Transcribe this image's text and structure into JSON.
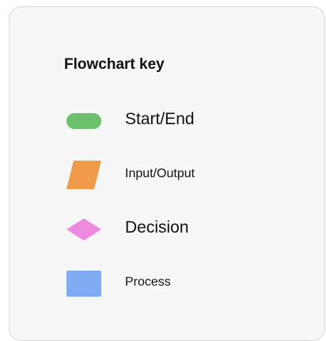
{
  "title": "Flowchart key",
  "items": [
    {
      "label": "Start/End",
      "shape": "terminal-pill-icon",
      "color": "#6cbf6b"
    },
    {
      "label": "Input/Output",
      "shape": "parallelogram-icon",
      "color": "#ef9a48"
    },
    {
      "label": "Decision",
      "shape": "diamond-icon",
      "color": "#ec8ae0"
    },
    {
      "label": "Process",
      "shape": "rectangle-icon",
      "color": "#80abf2"
    }
  ]
}
